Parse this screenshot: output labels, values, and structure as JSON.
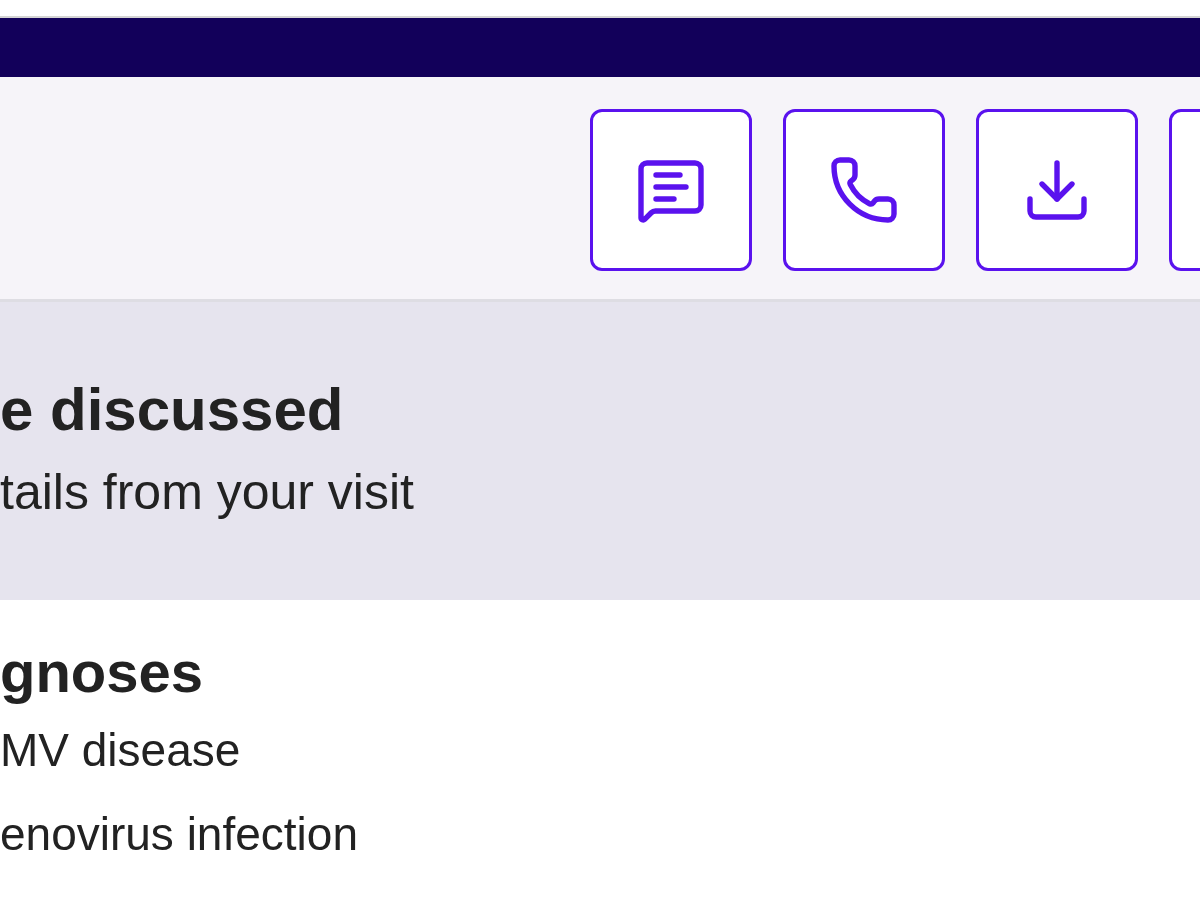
{
  "header": {
    "buttons": [
      {
        "kind": "message"
      },
      {
        "kind": "phone"
      },
      {
        "kind": "download"
      },
      {
        "kind": "blank"
      }
    ]
  },
  "summary": {
    "title": "e discussed",
    "subtitle": "tails from your visit"
  },
  "diagnoses": {
    "title": "gnoses",
    "items": [
      "MV disease",
      "enovirus infection"
    ]
  }
}
